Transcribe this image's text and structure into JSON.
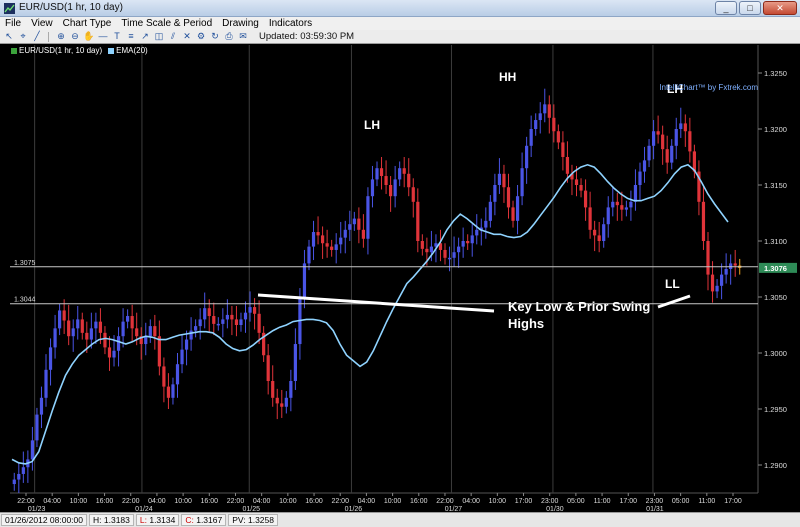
{
  "window": {
    "title": "EUR/USD(1 hr,  10 day)",
    "minimize": "_",
    "maximize": "□",
    "close": "✕"
  },
  "menu": [
    "File",
    "View",
    "Chart Type",
    "Time Scale & Period",
    "Drawing",
    "Indicators"
  ],
  "toolbar": {
    "tools": [
      "pointer-tool",
      "cursor-tool",
      "line-tool",
      "zoom-in-tool",
      "zoom-out-tool",
      "hand-tool",
      "horizontal-line-tool",
      "text-tool",
      "fib-tool",
      "arrow-tool",
      "eraser-tool",
      "channel-tool",
      "delete-tool",
      "settings-tool",
      "refresh-tool",
      "print-tool",
      "mail-tool"
    ],
    "updated": "Updated: 03:59:30 PM"
  },
  "chart": {
    "legend": [
      {
        "name": "EUR/USD(1 hr,  10 day)",
        "color": "#3ba33b"
      },
      {
        "name": "EMA(20)",
        "color": "#8fd3ff"
      }
    ],
    "credit": "IntelliChart™ by Fxtrek.com",
    "ylim": [
      1.2875,
      1.3275
    ],
    "y_ticks": [
      "1.3250",
      "1.3200",
      "1.3150",
      "1.3100",
      "1.3050",
      "1.3000",
      "1.2950",
      "1.2900"
    ],
    "current_price": "1.3076",
    "level_labels": [
      {
        "text": "1.3075",
        "price": 1.3077
      },
      {
        "text": "1.3044",
        "price": 1.3044
      }
    ],
    "x_time_labels": [
      "22:00",
      "04:00",
      "10:00",
      "16:00",
      "22:00",
      "04:00",
      "10:00",
      "16:00",
      "22:00",
      "04:00",
      "10:00",
      "16:00",
      "22:00",
      "04:00",
      "10:00",
      "16:00",
      "22:00",
      "04:00",
      "10:00",
      "17:00",
      "23:00",
      "05:00",
      "11:00",
      "17:00",
      "23:00",
      "05:00",
      "11:00",
      "17:00"
    ],
    "x_date_labels": [
      "01/23",
      "01/24",
      "01/25",
      "01/26",
      "01/27",
      "01/30",
      "01/31"
    ],
    "annotations": {
      "lh1": "LH",
      "hh": "HH",
      "lh2": "LH",
      "ll": "LL",
      "note_line1": "Key Low & Prior Swing",
      "note_line2": "Highs"
    },
    "colors": {
      "up_candle": "#4a55e6",
      "down_candle": "#e0343a",
      "ema": "#8fd3ff",
      "last_candle": "#f4a21c",
      "price_tag": "#2e8b57"
    }
  },
  "chart_data": {
    "type": "candlestick",
    "symbol": "EUR/USD",
    "interval": "1 hr",
    "period": "10 day",
    "ylim": [
      1.2875,
      1.3275
    ],
    "indicator": "EMA(20)",
    "horizontal_levels": [
      1.3077,
      1.3044
    ],
    "close_path": [
      1.2887,
      1.2892,
      1.2898,
      1.2905,
      1.2922,
      1.2945,
      1.296,
      1.2985,
      1.3005,
      1.3022,
      1.3038,
      1.3029,
      1.3015,
      1.3022,
      1.303,
      1.3018,
      1.3012,
      1.3022,
      1.3028,
      1.3018,
      1.3005,
      1.2996,
      1.3002,
      1.3015,
      1.3028,
      1.3033,
      1.3022,
      1.3015,
      1.3008,
      1.3015,
      1.3024,
      1.3015,
      1.2988,
      1.297,
      1.296,
      1.2972,
      1.299,
      1.3003,
      1.3012,
      1.302,
      1.3024,
      1.303,
      1.304,
      1.3033,
      1.3026,
      1.3026,
      1.303,
      1.3034,
      1.303,
      1.3025,
      1.303,
      1.3036,
      1.3041,
      1.3035,
      1.3018,
      1.2998,
      1.2975,
      1.296,
      1.2955,
      1.2952,
      1.296,
      1.2975,
      1.3008,
      1.305,
      1.308,
      1.3095,
      1.3108,
      1.3105,
      1.3098,
      1.3095,
      1.3092,
      1.3097,
      1.3103,
      1.311,
      1.3115,
      1.312,
      1.311,
      1.3102,
      1.314,
      1.3155,
      1.3165,
      1.3158,
      1.315,
      1.314,
      1.3155,
      1.3165,
      1.316,
      1.3148,
      1.3135,
      1.31,
      1.3093,
      1.309,
      1.3095,
      1.3098,
      1.3092,
      1.3085,
      1.3085,
      1.309,
      1.3095,
      1.31,
      1.3098,
      1.3105,
      1.311,
      1.3112,
      1.3118,
      1.3135,
      1.315,
      1.316,
      1.3148,
      1.313,
      1.3118,
      1.314,
      1.3165,
      1.3185,
      1.32,
      1.3208,
      1.3214,
      1.3222,
      1.321,
      1.3198,
      1.3188,
      1.3175,
      1.316,
      1.3155,
      1.315,
      1.3145,
      1.313,
      1.311,
      1.3105,
      1.31,
      1.3115,
      1.313,
      1.3135,
      1.3132,
      1.3128,
      1.313,
      1.3135,
      1.315,
      1.3162,
      1.3172,
      1.3185,
      1.3198,
      1.3195,
      1.3182,
      1.317,
      1.3185,
      1.32,
      1.3205,
      1.3198,
      1.318,
      1.3162,
      1.3135,
      1.31,
      1.307,
      1.3055,
      1.306,
      1.307,
      1.3075,
      1.308,
      1.3078,
      1.3076
    ],
    "ema_path": [
      1.2905,
      1.2902,
      1.2901,
      1.2903,
      1.2912,
      1.293,
      1.2948,
      1.2965,
      1.298,
      1.299,
      1.2998,
      1.3003,
      1.3008,
      1.3012,
      1.3013,
      1.3012,
      1.301,
      1.3008,
      1.301,
      1.3013,
      1.3015,
      1.3014,
      1.3012,
      1.3012,
      1.3014,
      1.3016,
      1.3017,
      1.3018,
      1.3019,
      1.3019,
      1.3018,
      1.3014,
      1.3008,
      1.3004,
      1.3002,
      1.3003,
      1.3007,
      1.3012,
      1.3016,
      1.302,
      1.3023,
      1.3025,
      1.3028,
      1.3029,
      1.303,
      1.303,
      1.3029,
      1.3027,
      1.302,
      1.3008,
      1.2998,
      1.2993,
      1.2988,
      1.2992,
      1.3002,
      1.3015,
      1.3028,
      1.304,
      1.3051,
      1.3062,
      1.3068,
      1.3075,
      1.3082,
      1.309,
      1.3099,
      1.311,
      1.3118,
      1.3124,
      1.312,
      1.3115,
      1.311,
      1.3108,
      1.3106,
      1.3106,
      1.3104,
      1.3103,
      1.3104,
      1.3108,
      1.3115,
      1.3123,
      1.3131,
      1.3139,
      1.3148,
      1.3156,
      1.3162,
      1.3166,
      1.3168,
      1.3166,
      1.316,
      1.3153,
      1.3147,
      1.3142,
      1.3138,
      1.3136,
      1.3136,
      1.3138,
      1.314,
      1.3145,
      1.3152,
      1.316,
      1.3166,
      1.3168,
      1.3163,
      1.3153,
      1.3142,
      1.3133,
      1.3125,
      1.3117
    ],
    "series": [
      {
        "name": "EUR/USD(1 hr,  10 day)"
      },
      {
        "name": "EMA(20)"
      }
    ],
    "annotations": [
      "LH",
      "HH",
      "LH",
      "LL",
      "Key Low & Prior Swing Highs"
    ]
  },
  "statusbar": {
    "datetime": "01/26/2012 08:00:00",
    "high_label": "H:",
    "high": "1.3183",
    "low_label": "L:",
    "low": "1.3134",
    "close_label": "C:",
    "close": "1.3167",
    "pv_label": "PV:",
    "pv": "1.3258"
  }
}
